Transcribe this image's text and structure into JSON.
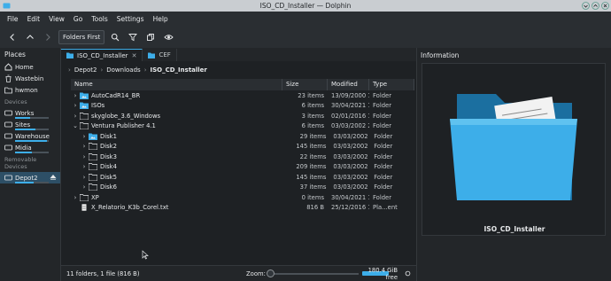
{
  "window": {
    "title": "ISO_CD_Installer — Dolphin"
  },
  "menu": [
    "File",
    "Edit",
    "View",
    "Go",
    "Tools",
    "Settings",
    "Help"
  ],
  "toolbar": {
    "back_icon": "chevron-left-icon",
    "up_icon": "chevron-up-icon",
    "forward_icon": "chevron-right-icon",
    "folders_first_label": "Folders First",
    "search_icon": "search-icon",
    "filter_icon": "filter-icon",
    "terminal_icon": "copy-icon",
    "preview_icon": "eye-icon"
  },
  "places": {
    "heading": "Places",
    "items": [
      {
        "label": "Home",
        "icon": "home-icon"
      },
      {
        "label": "Wastebin",
        "icon": "trash-icon"
      },
      {
        "label": "hwmon",
        "icon": "folder-icon"
      }
    ],
    "devices_label": "Devices",
    "devices": [
      {
        "label": "Works",
        "usage": 0.45
      },
      {
        "label": "Sites",
        "usage": 0.6
      },
      {
        "label": "Warehouse",
        "usage": 0.95
      },
      {
        "label": "Midia",
        "usage": 0.5
      }
    ],
    "removable_label": "Removable Devices",
    "removable": [
      {
        "label": "Depot2",
        "usage": 0.55
      }
    ]
  },
  "tabs": [
    {
      "label": "ISO_CD_Installer",
      "active": true
    },
    {
      "label": "CEF",
      "active": false
    }
  ],
  "breadcrumb": [
    "Depot2",
    "Downloads",
    "ISO_CD_Installer"
  ],
  "columns": {
    "name": "Name",
    "size": "Size",
    "modified": "Modified",
    "type": "Type"
  },
  "files": [
    {
      "name": "AutoCadR14_BR",
      "size": "23 items",
      "modified": "13/09/2000 16:01",
      "type": "Folder",
      "depth": 0,
      "expander": "›",
      "icon": "folder-image"
    },
    {
      "name": "ISOs",
      "size": "6 items",
      "modified": "30/04/2021 13:02",
      "type": "Folder",
      "depth": 0,
      "expander": "›",
      "icon": "folder-image"
    },
    {
      "name": "skyglobe_3.6_Windows",
      "size": "3 items",
      "modified": "02/01/2016 11:16",
      "type": "Folder",
      "depth": 0,
      "expander": "›",
      "icon": "folder"
    },
    {
      "name": "Ventura Publisher 4.1",
      "size": "6 items",
      "modified": "03/03/2002 20:03",
      "type": "Folder",
      "depth": 0,
      "expander": "⌄",
      "icon": "folder"
    },
    {
      "name": "Disk1",
      "size": "29 items",
      "modified": "03/03/2002 20:03",
      "type": "Folder",
      "depth": 1,
      "expander": "›",
      "icon": "folder-image"
    },
    {
      "name": "Disk2",
      "size": "145 items",
      "modified": "03/03/2002 20:03",
      "type": "Folder",
      "depth": 1,
      "expander": "›",
      "icon": "folder"
    },
    {
      "name": "Disk3",
      "size": "22 items",
      "modified": "03/03/2002 20:03",
      "type": "Folder",
      "depth": 1,
      "expander": "›",
      "icon": "folder"
    },
    {
      "name": "Disk4",
      "size": "209 items",
      "modified": "03/03/2002 20:03",
      "type": "Folder",
      "depth": 1,
      "expander": "›",
      "icon": "folder"
    },
    {
      "name": "Disk5",
      "size": "145 items",
      "modified": "03/03/2002 20:03",
      "type": "Folder",
      "depth": 1,
      "expander": "›",
      "icon": "folder"
    },
    {
      "name": "Disk6",
      "size": "37 items",
      "modified": "03/03/2002 20:03",
      "type": "Folder",
      "depth": 1,
      "expander": "›",
      "icon": "folder"
    },
    {
      "name": "XP",
      "size": "0 items",
      "modified": "30/04/2021 13:02",
      "type": "Folder",
      "depth": 0,
      "expander": "›",
      "icon": "folder"
    },
    {
      "name": "X_Relatorio_K3b_Corel.txt",
      "size": "816 B",
      "modified": "25/12/2016 16:43",
      "type": "Pla...ent",
      "depth": 0,
      "expander": "",
      "icon": "text-file"
    }
  ],
  "status": {
    "summary": "11 folders, 1 file (816 B)",
    "zoom_label": "Zoom:",
    "free_space": "180.4 GiB free"
  },
  "info": {
    "heading": "Information",
    "name": "ISO_CD_Installer"
  },
  "colors": {
    "accent": "#3daee9",
    "folder": "#3daee9",
    "window_bg": "#1e2124"
  }
}
